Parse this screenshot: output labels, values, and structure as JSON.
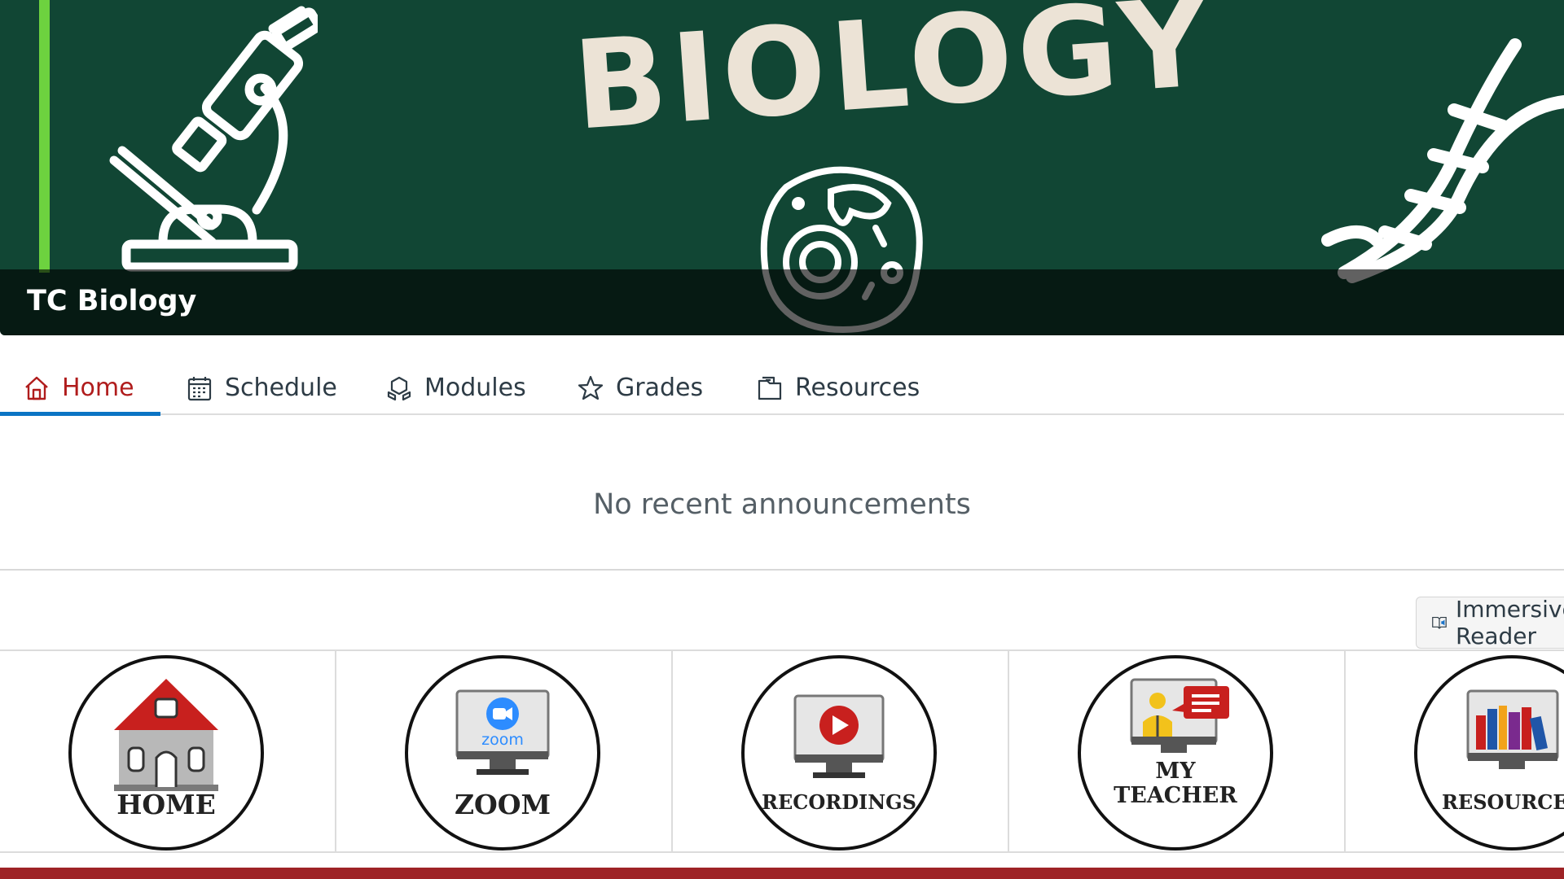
{
  "banner": {
    "art_title": "BIOLOGY",
    "course_title": "TC Biology",
    "colors": {
      "background": "#114634",
      "accent": "#6dd23f",
      "art_text": "#ece3d6"
    }
  },
  "nav": {
    "tabs": [
      {
        "label": "Home",
        "icon": "home-icon",
        "active": true
      },
      {
        "label": "Schedule",
        "icon": "calendar-icon",
        "active": false
      },
      {
        "label": "Modules",
        "icon": "modules-icon",
        "active": false
      },
      {
        "label": "Grades",
        "icon": "star-icon",
        "active": false
      },
      {
        "label": "Resources",
        "icon": "folder-icon",
        "active": false
      }
    ]
  },
  "announcements": {
    "empty_text": "No recent announcements"
  },
  "immersive_reader": {
    "label": "Immersive Reader",
    "icon": "immersive-reader-icon"
  },
  "tiles": [
    {
      "label": "HOME",
      "icon": "house-icon"
    },
    {
      "label": "ZOOM",
      "icon": "zoom-monitor-icon",
      "screen_text": "zoom"
    },
    {
      "label": "RECORDINGS",
      "icon": "play-monitor-icon"
    },
    {
      "label_line1": "MY",
      "label_line2": "TEACHER",
      "icon": "teacher-monitor-icon"
    },
    {
      "label": "RESOURCES",
      "icon": "books-monitor-icon"
    }
  ],
  "colors": {
    "active_tab": "#b01c1c",
    "tab_underline": "#0b74c4",
    "footer": "#9e2326"
  }
}
